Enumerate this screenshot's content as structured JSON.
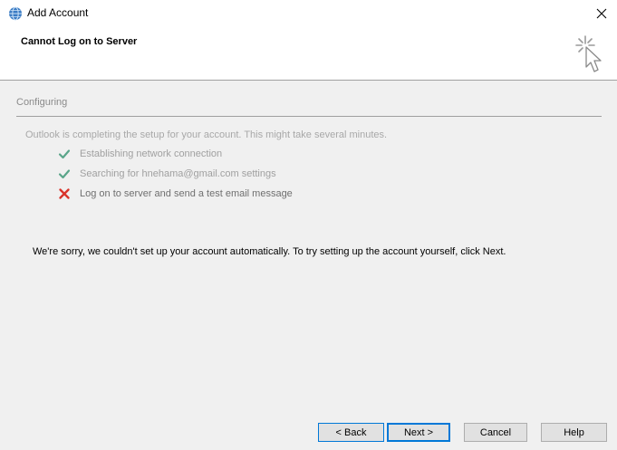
{
  "window": {
    "title": "Add Account",
    "close_glyph": "✕"
  },
  "header": {
    "title": "Cannot Log on to Server"
  },
  "content": {
    "section_title": "Configuring",
    "intro": "Outlook is completing the setup for your account. This might take several minutes.",
    "steps": [
      {
        "label": "Establishing network connection",
        "status": "done",
        "icon": "checkmark-icon"
      },
      {
        "label": "Searching for hnehama@gmail.com settings",
        "status": "done",
        "icon": "checkmark-icon"
      },
      {
        "label": "Log on to server and send a test email message",
        "status": "failed",
        "icon": "error-x-icon"
      }
    ],
    "message": "We're sorry, we couldn't set up your account automatically. To try setting up the account yourself, click Next."
  },
  "buttons": {
    "back": "< Back",
    "next": "Next >",
    "cancel": "Cancel",
    "help": "Help"
  },
  "colors": {
    "check": "#5aa58a",
    "error": "#d9342b",
    "accent": "#0078d7"
  }
}
